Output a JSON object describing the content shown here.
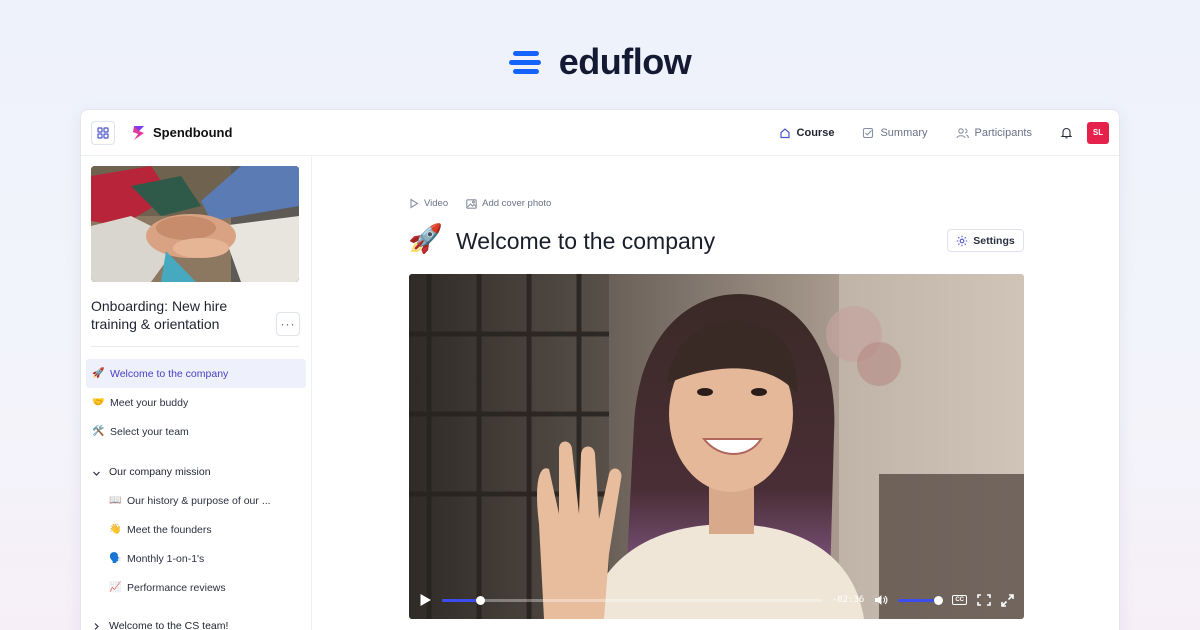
{
  "brand": {
    "name": "eduflow",
    "color": "#1463ff"
  },
  "org": {
    "name": "Spendbound",
    "icon": "spendbound-logo"
  },
  "nav": [
    {
      "label": "Course",
      "icon": "home-icon",
      "active": true
    },
    {
      "label": "Summary",
      "icon": "checkbox-icon",
      "active": false
    },
    {
      "label": "Participants",
      "icon": "users-icon",
      "active": false
    }
  ],
  "user": {
    "initials": "SL",
    "color": "#e5214c"
  },
  "course": {
    "title": "Onboarding: New hire training & orientation",
    "more_label": "···"
  },
  "lessons": [
    {
      "emoji": "🚀",
      "label": "Welcome to the company",
      "active": true
    },
    {
      "emoji": "🤝",
      "label": "Meet your buddy"
    },
    {
      "emoji": "🛠️",
      "label": "Select your team"
    }
  ],
  "sections": [
    {
      "label": "Our company mission",
      "expanded": true,
      "items": [
        {
          "emoji": "📖",
          "label": "Our history & purpose of our ..."
        },
        {
          "emoji": "👋",
          "label": "Meet the founders"
        },
        {
          "emoji": "🗣️",
          "label": "Monthly 1-on-1's"
        },
        {
          "emoji": "📈",
          "label": "Performance reviews"
        }
      ]
    },
    {
      "label": "Welcome to the CS team!",
      "expanded": false
    }
  ],
  "lesson": {
    "emoji": "🚀",
    "title": "Welcome to the company",
    "meta": {
      "video_label": "Video",
      "cover_label": "Add cover photo"
    },
    "settings_label": "Settings"
  },
  "video": {
    "time_remaining": "-02:36",
    "progress": 0.1,
    "volume": 0.9,
    "cc_label": "CC"
  }
}
